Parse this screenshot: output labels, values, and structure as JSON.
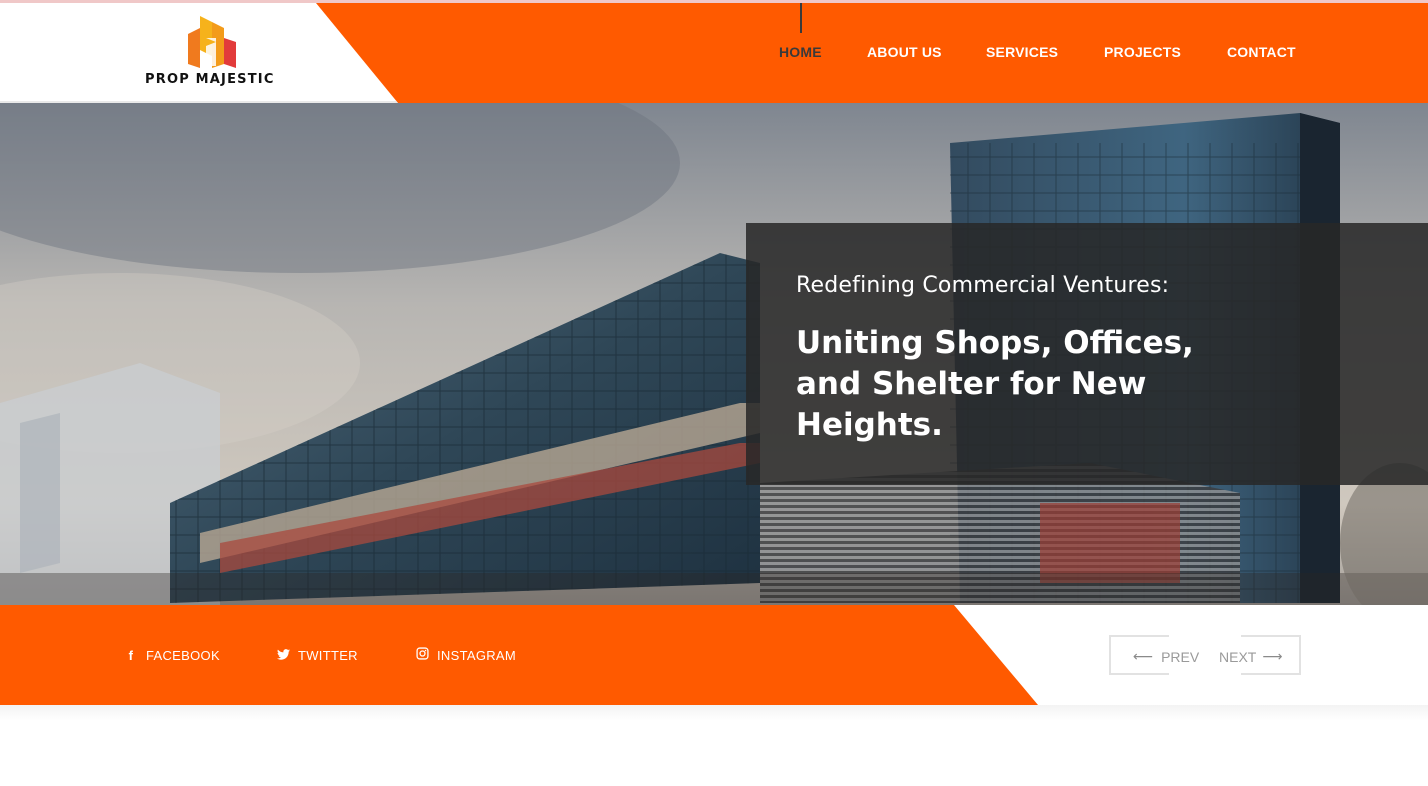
{
  "brand": {
    "name": "PROP MAJESTIC",
    "colors": {
      "accent": "#ff5a00",
      "dark": "#3a3a3a",
      "logo_yellow": "#f6b21b",
      "logo_orange": "#f07a1e",
      "logo_red": "#e23b3b"
    }
  },
  "nav": {
    "items": [
      {
        "label": "HOME",
        "active": true
      },
      {
        "label": "ABOUT US"
      },
      {
        "label": "SERVICES"
      },
      {
        "label": "PROJECTS"
      },
      {
        "label": "CONTACT"
      }
    ]
  },
  "hero": {
    "subtitle": "Redefining Commercial Ventures:",
    "title": "Uniting Shops, Offices, and Shelter for New Heights."
  },
  "social": {
    "items": [
      {
        "label": "FACEBOOK",
        "icon": "facebook-icon"
      },
      {
        "label": "TWITTER",
        "icon": "twitter-icon"
      },
      {
        "label": "INSTAGRAM",
        "icon": "instagram-icon"
      }
    ]
  },
  "pager": {
    "prev_label": "PREV",
    "next_label": "NEXT",
    "prev_icon": "arrow-left-icon",
    "next_icon": "arrow-right-icon"
  }
}
